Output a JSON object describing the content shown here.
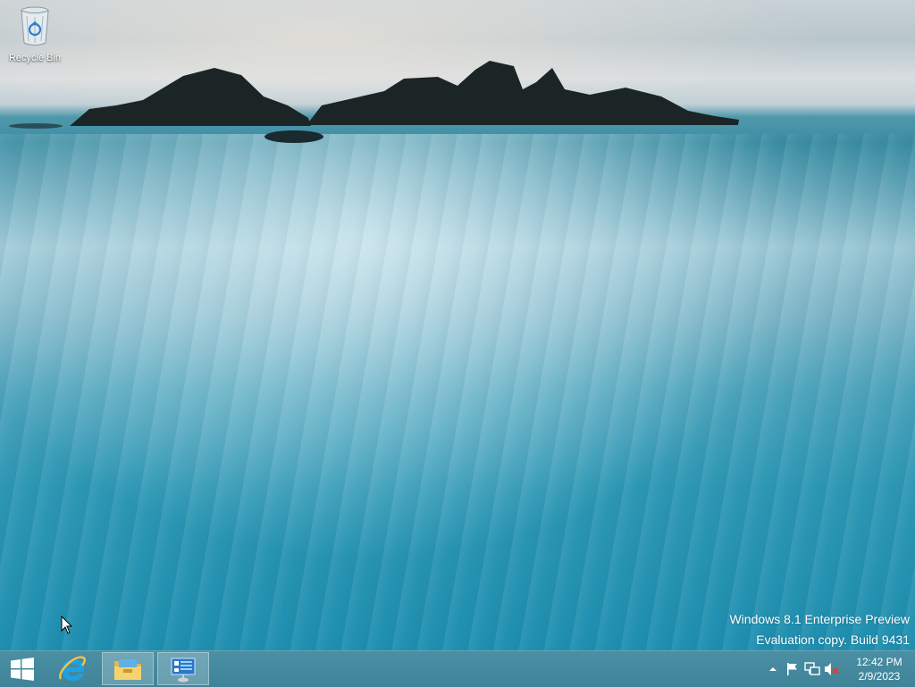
{
  "desktop": {
    "icons": [
      {
        "label": "Recycle Bin",
        "icon": "recycle-bin-icon"
      }
    ],
    "watermark": {
      "line1": "Windows 8.1 Enterprise Preview",
      "line2": "Evaluation copy. Build 9431"
    }
  },
  "taskbar": {
    "start_icon": "windows-logo-icon",
    "pinned": [
      {
        "name": "Internet Explorer",
        "icon": "internet-explorer-icon",
        "active": false
      },
      {
        "name": "File Explorer",
        "icon": "file-explorer-icon",
        "active": true
      },
      {
        "name": "Server Manager",
        "icon": "server-manager-icon",
        "active": true
      }
    ],
    "tray": {
      "icons": [
        "show-hidden-icons-arrow",
        "action-center-flag-icon",
        "network-icon",
        "volume-muted-icon"
      ],
      "time": "12:42 PM",
      "date": "2/9/2023"
    }
  }
}
